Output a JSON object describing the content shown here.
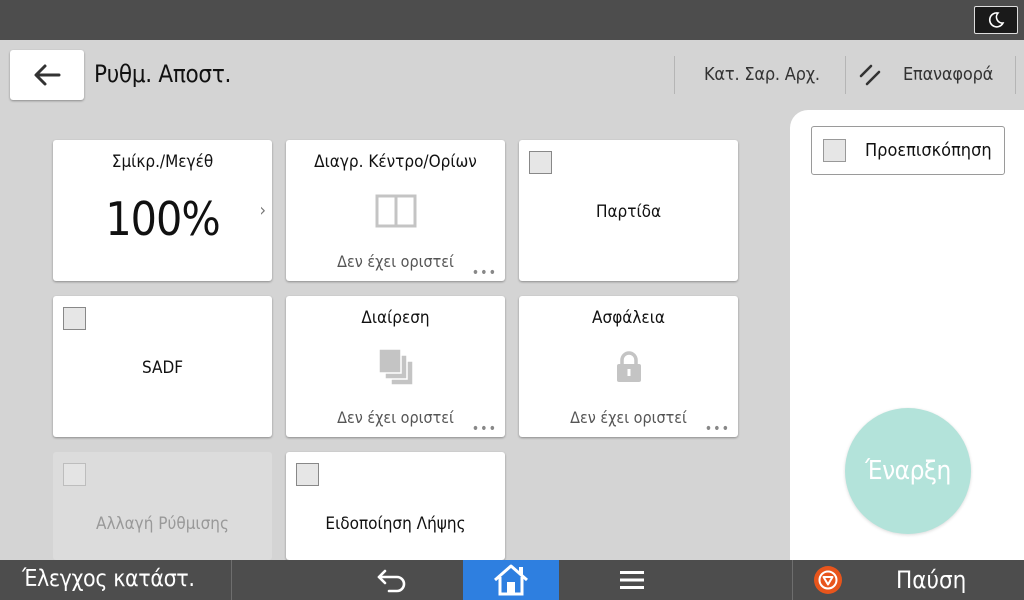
{
  "header": {
    "title": "Ρυθμ. Αποστ.",
    "original_type_label": "Κατ. Σαρ. Αρχ.",
    "reset_label": "Επαναφορά"
  },
  "tiles": {
    "reduce_enlarge": {
      "label": "Σμίκρ./Μεγέθ",
      "value": "100%"
    },
    "erase_border": {
      "label": "Διαγρ. Κέντρο/Ορίων",
      "status": "Δεν έχει οριστεί"
    },
    "batch": {
      "label": "Παρτίδα",
      "checked": false
    },
    "sadf": {
      "label": "SADF",
      "checked": false
    },
    "divide": {
      "label": "Διαίρεση",
      "status": "Δεν έχει οριστεί"
    },
    "security": {
      "label": "Ασφάλεια",
      "status": "Δεν έχει οριστεί"
    },
    "change_setting": {
      "label": "Αλλαγή Ρύθμισης",
      "checked": false,
      "disabled": true
    },
    "reception_notice": {
      "label": "Ειδοποίηση Λήψης",
      "checked": false
    }
  },
  "right_panel": {
    "preview_label": "Προεπισκόπηση",
    "preview_checked": false,
    "start_label": "Έναρξη"
  },
  "bottom_bar": {
    "status_check_label": "Έλεγχος κατάστ.",
    "pause_label": "Παύση"
  },
  "icons": {
    "sleep": "moon-icon",
    "back": "arrow-left-icon",
    "reset": "double-slash-icon",
    "erase_border": "two-pages-icon",
    "divide": "stacked-pages-icon",
    "security": "lock-icon",
    "undo": "return-arrow-icon",
    "home": "home-icon",
    "menu": "menu-icon",
    "stop": "stop-icon"
  },
  "colors": {
    "home_active": "#2e7fe0",
    "start_button": "#b3e3da",
    "stop_icon": "#e8551c",
    "bar_background": "#4d4d4d"
  }
}
